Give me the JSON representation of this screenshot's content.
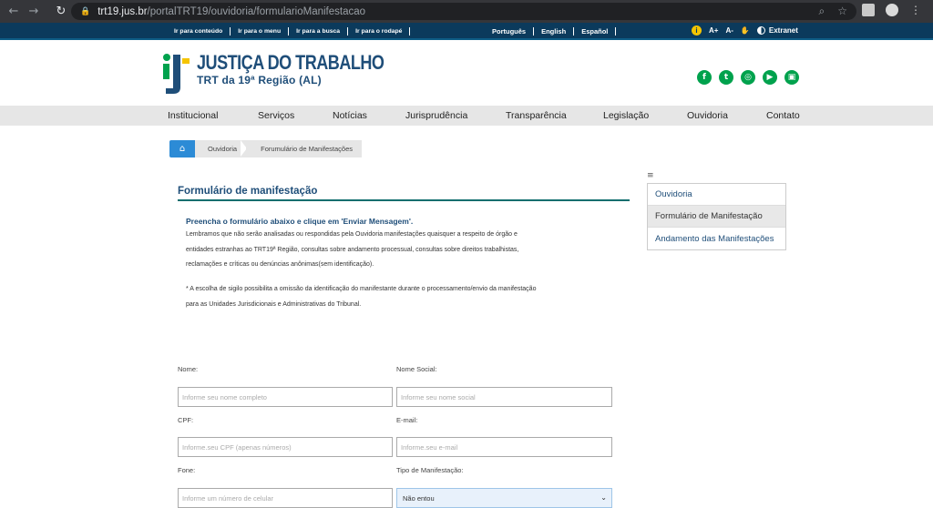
{
  "browser": {
    "url_host": "trt19.jus.br",
    "url_path": "/portalTRT19/ouvidoria/formularioManifestacao"
  },
  "accessibility_bar": {
    "links": [
      "Ir para conteúdo",
      "Ir para o menu",
      "Ir para a busca",
      "Ir para o rodapé"
    ],
    "languages": [
      "Português",
      "English",
      "Español"
    ],
    "font_increase": "A+",
    "font_decrease": "A-",
    "extranet": "Extranet"
  },
  "header": {
    "logo_title": "JUSTIÇA DO TRABALHO",
    "logo_subtitle": "TRT da 19ª Região (AL)",
    "socials": [
      "facebook-icon",
      "twitter-icon",
      "instagram-icon",
      "youtube-icon",
      "flickr-icon"
    ],
    "brand_color": "#1f4e79",
    "social_color": "#00a24d"
  },
  "nav": {
    "items": [
      "Institucional",
      "Serviços",
      "Notícias",
      "Jurisprudência",
      "Transparência",
      "Legislação",
      "Ouvidoria",
      "Contato"
    ]
  },
  "breadcrumb": {
    "items": [
      "Ouvidoria",
      "Forumulário de Manifestações"
    ]
  },
  "content": {
    "title": "Formulário de manifestação",
    "lead": "Preencha o formulário abaixo e clique em 'Enviar Mensagem'.",
    "para1_lines": [
      "Lembramos que não serão analisadas ou respondidas pela Ouvidoria manifestações quaisquer a respeito de órgão e",
      "entidades estranhas ao TRT19ª Região, consultas sobre andamento processual, consultas sobre direitos trabalhistas,",
      "reclamações e críticas ou denúncias anônimas(sem identificação)."
    ],
    "para2_lines": [
      "* A escolha de sigilo possibilita a omissão da identificação do manifestante durante o processamento/envio da manifestação",
      "para as Unidades Jurisdicionais e Administrativas do Tribunal."
    ]
  },
  "sidebar": {
    "items": [
      "Ouvidoria",
      "Formulário de Manifestação",
      "Andamento das Manifestações"
    ],
    "active_index": 1
  },
  "form": {
    "nome_label": "Nome:",
    "nome_placeholder": "Informe seu nome completo",
    "nome_social_label": "Nome Social:",
    "nome_social_placeholder": "Informe seu nome social",
    "cpf_label": "CPF:",
    "cpf_placeholder": "Informe.seu CPF (apenas números)",
    "email_label": "E-mail:",
    "email_placeholder": "Informe.seu e-mail",
    "fone_label": "Fone:",
    "fone_placeholder": "Informe um número de celular",
    "tipo_label": "Tipo de Manifestação:",
    "tipo_selected": "Não entou"
  }
}
